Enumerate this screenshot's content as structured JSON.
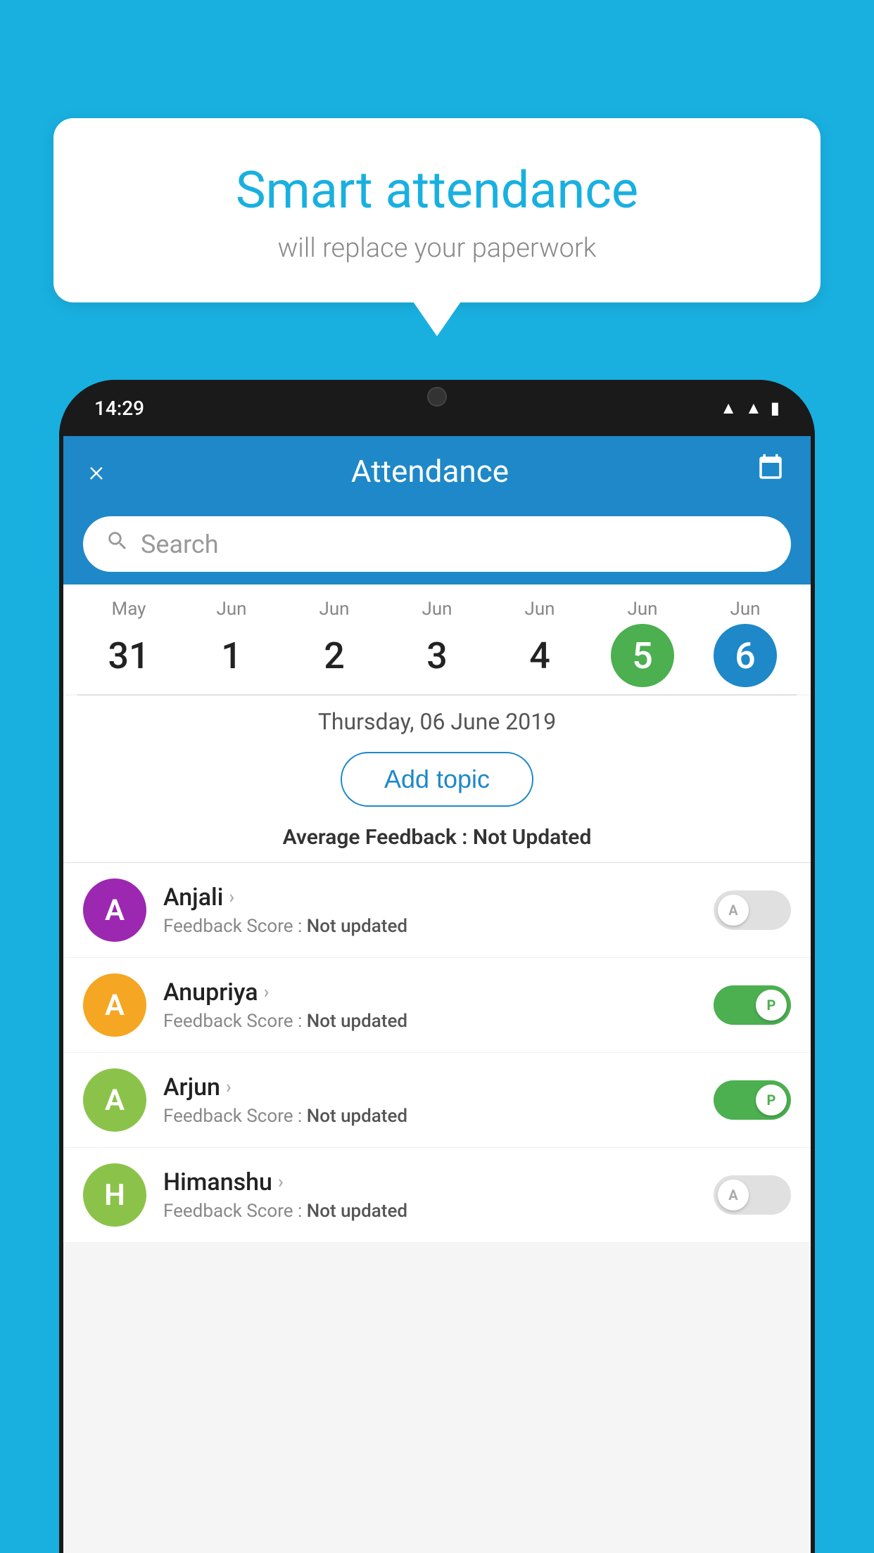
{
  "background_color": "#19b0e0",
  "speech_bubble": {
    "title": "Smart attendance",
    "subtitle": "will replace your paperwork"
  },
  "phone": {
    "status_bar": {
      "time": "14:29"
    },
    "app_header": {
      "title": "Attendance",
      "close_label": "×",
      "calendar_icon": "calendar-icon"
    },
    "search": {
      "placeholder": "Search"
    },
    "calendar": {
      "days": [
        {
          "month": "May",
          "date": "31",
          "state": "normal"
        },
        {
          "month": "Jun",
          "date": "1",
          "state": "normal"
        },
        {
          "month": "Jun",
          "date": "2",
          "state": "normal"
        },
        {
          "month": "Jun",
          "date": "3",
          "state": "normal"
        },
        {
          "month": "Jun",
          "date": "4",
          "state": "normal"
        },
        {
          "month": "Jun",
          "date": "5",
          "state": "today"
        },
        {
          "month": "Jun",
          "date": "6",
          "state": "selected"
        }
      ]
    },
    "selected_date": "Thursday, 06 June 2019",
    "add_topic_label": "Add topic",
    "average_feedback": {
      "label": "Average Feedback : ",
      "value": "Not Updated"
    },
    "students": [
      {
        "name": "Anjali",
        "feedback_label": "Feedback Score : ",
        "feedback_value": "Not updated",
        "avatar_letter": "A",
        "avatar_color": "#9c27b0",
        "toggle_state": "off",
        "toggle_label": "A"
      },
      {
        "name": "Anupriya",
        "feedback_label": "Feedback Score : ",
        "feedback_value": "Not updated",
        "avatar_letter": "A",
        "avatar_color": "#f5a623",
        "toggle_state": "on",
        "toggle_label": "P"
      },
      {
        "name": "Arjun",
        "feedback_label": "Feedback Score : ",
        "feedback_value": "Not updated",
        "avatar_letter": "A",
        "avatar_color": "#8bc34a",
        "toggle_state": "on",
        "toggle_label": "P"
      },
      {
        "name": "Himanshu",
        "feedback_label": "Feedback Score : ",
        "feedback_value": "Not updated",
        "avatar_letter": "H",
        "avatar_color": "#8bc34a",
        "toggle_state": "off",
        "toggle_label": "A"
      }
    ]
  }
}
